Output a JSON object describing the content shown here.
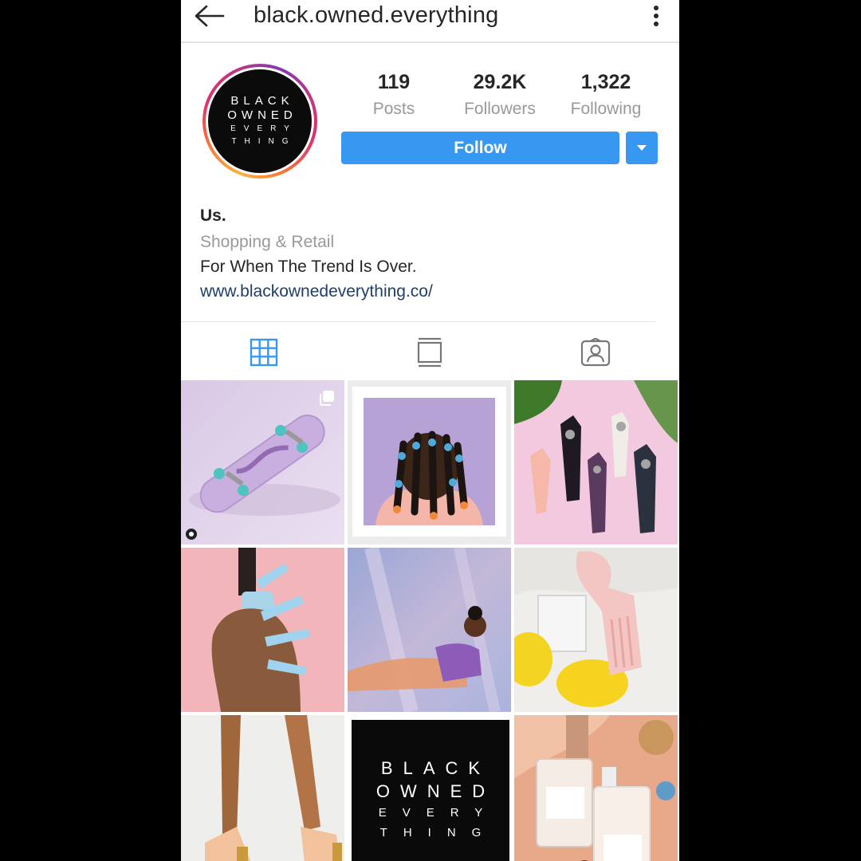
{
  "header": {
    "back_icon": "arrow-left-icon",
    "username": "black.owned.everything",
    "more_icon": "more-vertical-icon"
  },
  "profile": {
    "avatar_text": {
      "line1": "BLACK",
      "line2": "OWNED",
      "line3": "EVERY",
      "line4": "THING"
    },
    "stats": [
      {
        "value": "119",
        "label": "Posts"
      },
      {
        "value": "29.2K",
        "label": "Followers"
      },
      {
        "value": "1,322",
        "label": "Following"
      }
    ],
    "follow_label": "Follow",
    "accent_color": "#3897f0"
  },
  "bio": {
    "name": "Us.",
    "category": "Shopping & Retail",
    "text": "For When The Trend Is Over.",
    "link": "www.blackownedeverything.co/"
  },
  "tabs": [
    {
      "icon": "grid-icon",
      "active": true
    },
    {
      "icon": "feed-icon",
      "active": false
    },
    {
      "icon": "tagged-icon",
      "active": false
    }
  ],
  "posts": [
    {
      "subject": "skateboard",
      "icon": "multiple-posts-icon"
    },
    {
      "subject": "braided-hair-portrait"
    },
    {
      "subject": "crystal-pipes"
    },
    {
      "subject": "nail-polish-hand"
    },
    {
      "subject": "reclining-woman"
    },
    {
      "subject": "hair-pick-lemons"
    },
    {
      "subject": "heels"
    },
    {
      "subject": "logo-tile",
      "text": {
        "line1": "BLACK",
        "line2": "OWNED",
        "line3": "EVERY",
        "line4": "THING"
      }
    },
    {
      "subject": "perfume-bottles"
    }
  ]
}
